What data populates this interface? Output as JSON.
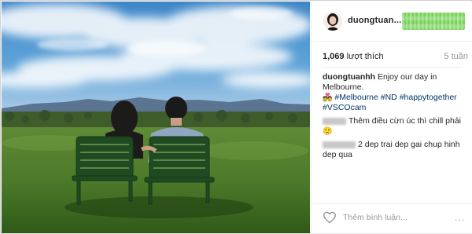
{
  "post": {
    "header": {
      "username": "duongtuan..."
    },
    "likes": {
      "count": "1,069",
      "label": "lượt thích"
    },
    "time_ago": "5 tuần",
    "caption": {
      "username": "duongtuanhh",
      "text": "Enjoy our day in Melbourne.",
      "tags": [
        "#Melbourne",
        "#ND",
        "#happytogether",
        "#VSCOcam"
      ]
    },
    "comments": [
      {
        "text": "Thêm điều cừn úc thì chill phải"
      },
      {
        "text": "2 dep trai dep gai chup hinh dep qua"
      }
    ],
    "footer": {
      "comment_placeholder": "Thêm bình luận...",
      "more_label": "..."
    }
  },
  "colors": {
    "tag_blue": "#003569",
    "like_button_badge": "#77d25a",
    "muted_text": "#999999"
  },
  "icons": {
    "like": "heart-outline-icon",
    "more": "more-dots-icon"
  }
}
